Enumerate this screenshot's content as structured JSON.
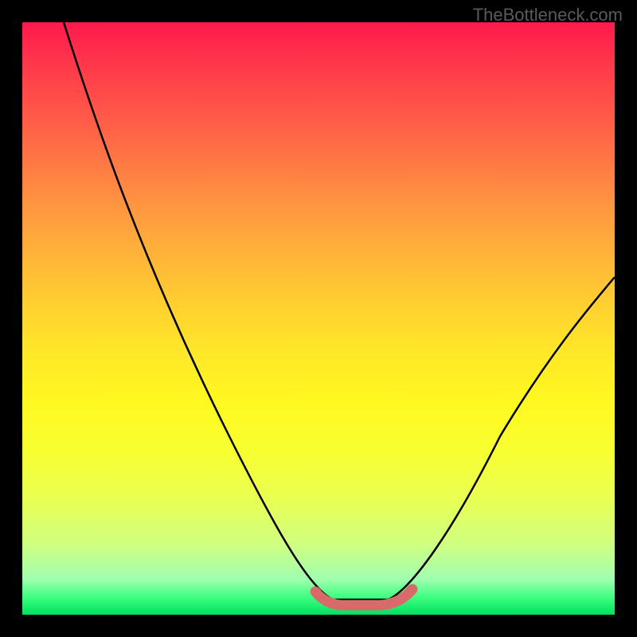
{
  "watermark": "TheBottleneck.com",
  "chart_data": {
    "type": "line",
    "title": "",
    "xlabel": "",
    "ylabel": "",
    "xlim": [
      0,
      100
    ],
    "ylim": [
      0,
      100
    ],
    "series": [
      {
        "name": "curve",
        "x": [
          7,
          15,
          25,
          35,
          45,
          50,
          55,
          60,
          65,
          70,
          80,
          90,
          100
        ],
        "y": [
          100,
          84,
          62,
          40,
          20,
          8,
          2,
          2,
          2,
          9,
          24,
          42,
          58
        ]
      },
      {
        "name": "highlight",
        "x": [
          50,
          55,
          60,
          65
        ],
        "y": [
          4,
          2,
          2,
          4
        ]
      }
    ],
    "legend": false,
    "grid": false
  }
}
